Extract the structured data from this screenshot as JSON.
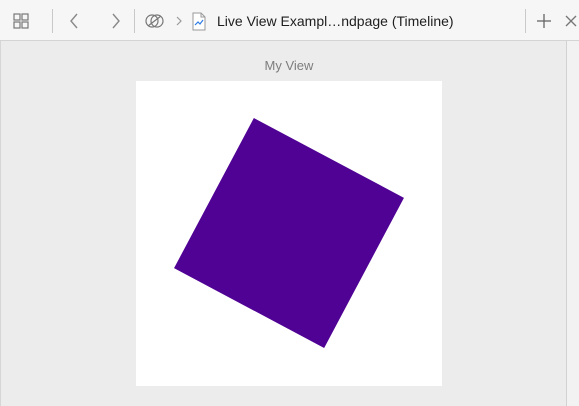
{
  "toolbar": {
    "breadcrumb_title": "Live View Exampl…ndpage (Timeline)",
    "icons": {
      "grid": "grid-view-icon",
      "back": "chevron-left-icon",
      "forward": "chevron-right-icon",
      "related": "related-items-icon",
      "file": "playground-file-icon",
      "add": "plus-icon",
      "close": "close-icon"
    }
  },
  "live_view": {
    "title": "My View",
    "square_color": "#4f0294",
    "background": "#ffffff",
    "square_rotation_degrees": 28
  }
}
